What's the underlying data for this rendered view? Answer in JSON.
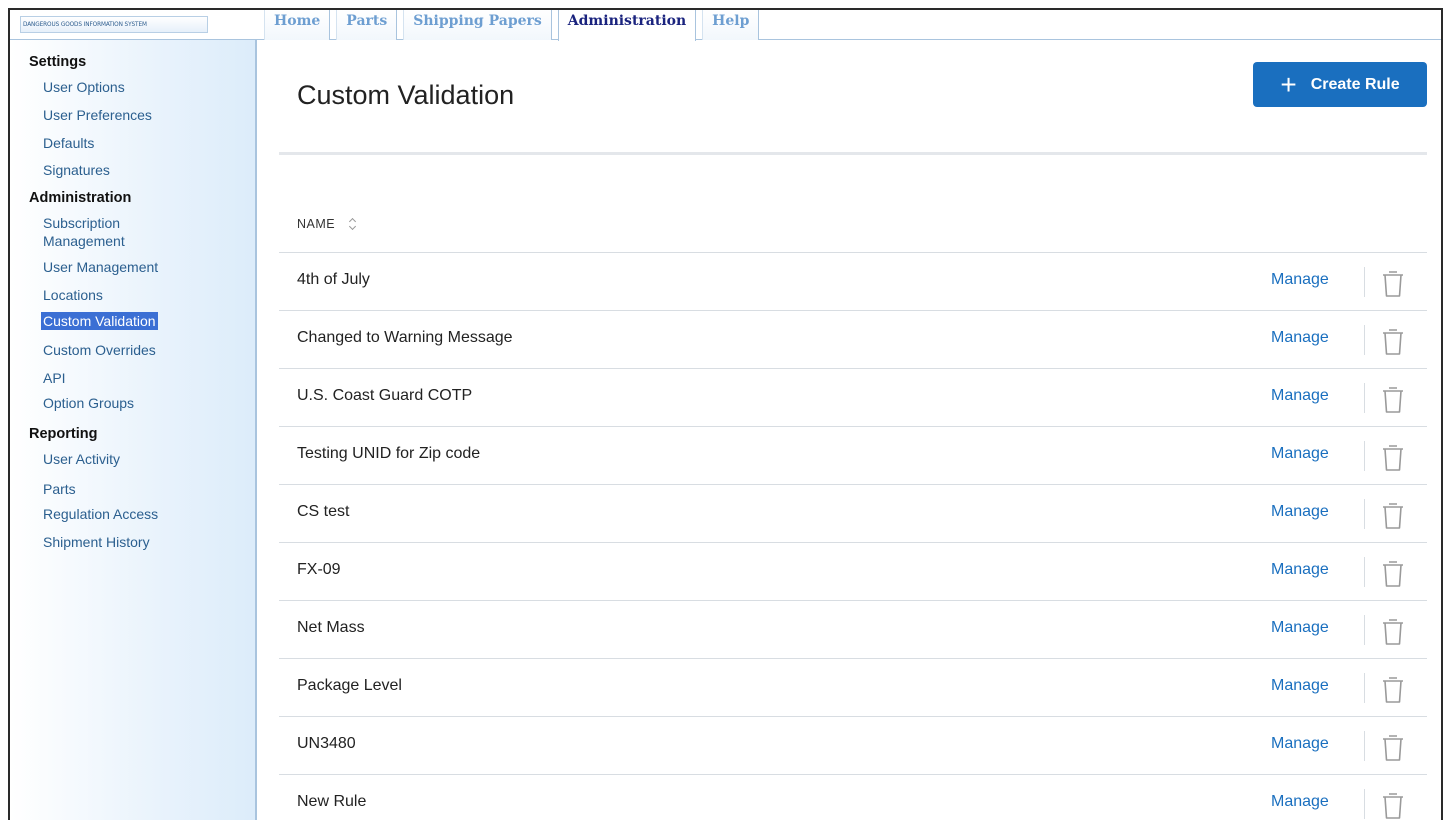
{
  "app": {
    "logo_text": "DANGEROUS GOODS INFORMATION SYSTEM"
  },
  "tabs": [
    {
      "label": "Home",
      "active": false
    },
    {
      "label": "Parts",
      "active": false
    },
    {
      "label": "Shipping Papers",
      "active": false
    },
    {
      "label": "Administration",
      "active": true
    },
    {
      "label": "Help",
      "active": false
    }
  ],
  "sidebar": {
    "settings": {
      "title": "Settings",
      "items": [
        "User Options",
        "User Preferences",
        "Defaults",
        "Signatures"
      ]
    },
    "administration": {
      "title": "Administration",
      "items": [
        "Subscription Management",
        "User Management",
        "Locations",
        "Custom Validation",
        "Custom Overrides",
        "API",
        "Option Groups"
      ],
      "active": "Custom Validation"
    },
    "reporting": {
      "title": "Reporting",
      "items": [
        "User Activity",
        "Parts",
        "Regulation Access",
        "Shipment History"
      ]
    }
  },
  "main": {
    "title": "Custom Validation",
    "create_button": "Create Rule",
    "table": {
      "column_name": "NAME",
      "action_label": "Manage",
      "rows": [
        "4th of July",
        "Changed to Warning Message",
        "U.S. Coast Guard COTP",
        "Testing UNID for Zip code",
        "CS test",
        "FX-09",
        "Net Mass",
        "Package Level",
        "UN3480",
        "New Rule"
      ]
    }
  },
  "colors": {
    "accent": "#1a6fbf",
    "highlight": "#e0141e",
    "active_nav": "#3b6fd4"
  }
}
